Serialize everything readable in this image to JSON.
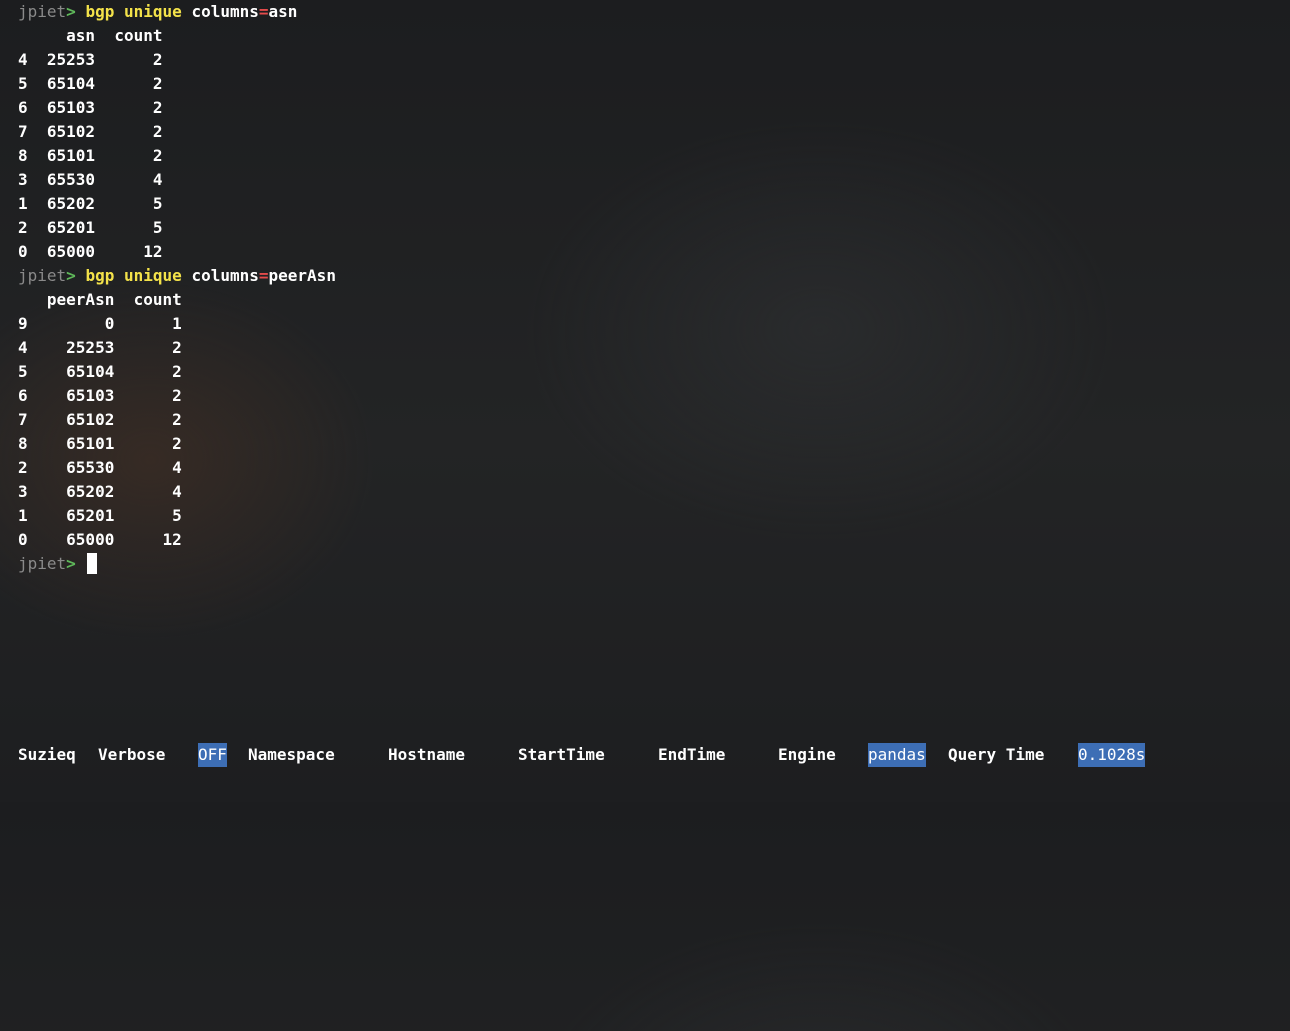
{
  "prompt": {
    "user": "jpiet",
    "symbol": ">"
  },
  "commands": [
    {
      "verb1": "bgp",
      "verb2": "unique",
      "arg_key": "columns",
      "eq": "=",
      "arg_val": "asn",
      "header": "     asn  count",
      "rows": [
        "4  25253      2",
        "5  65104      2",
        "6  65103      2",
        "7  65102      2",
        "8  65101      2",
        "3  65530      4",
        "1  65202      5",
        "2  65201      5",
        "0  65000     12"
      ]
    },
    {
      "verb1": "bgp",
      "verb2": "unique",
      "arg_key": "columns",
      "eq": "=",
      "arg_val": "peerAsn",
      "header": "   peerAsn  count",
      "rows": [
        "9        0      1",
        "4    25253      2",
        "5    65104      2",
        "6    65103      2",
        "7    65102      2",
        "8    65101      2",
        "2    65530      4",
        "3    65202      4",
        "1    65201      5",
        "0    65000     12"
      ]
    }
  ],
  "status_bar": {
    "app": "Suzieq",
    "verbose_label": "Verbose",
    "verbose_value": "OFF",
    "namespace_label": "Namespace",
    "hostname_label": "Hostname",
    "starttime_label": "StartTime",
    "endtime_label": "EndTime",
    "engine_label": "Engine",
    "engine_value": "pandas",
    "querytime_label": "Query Time",
    "querytime_value": "0.1028s"
  },
  "colors": {
    "highlight": "#3d6eb5",
    "prompt_arrow": "#5fb85a",
    "command_keyword": "#f3e24a",
    "equals": "#e44b4b"
  }
}
